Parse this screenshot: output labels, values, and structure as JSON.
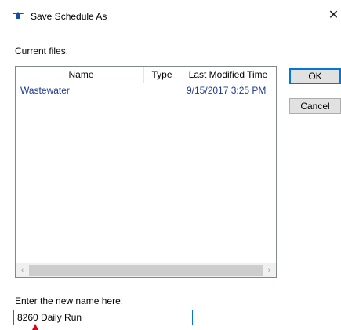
{
  "dialog": {
    "title": "Save Schedule As",
    "close_glyph": "✕",
    "icon": "app-logo-icon"
  },
  "current_files_label": "Current files:",
  "file_list": {
    "columns": [
      "Name",
      "Type",
      "Last Modified Time"
    ],
    "rows": [
      {
        "name": "Wastewater",
        "type": "",
        "last_modified": "9/15/2017 3:25 PM"
      }
    ],
    "scroll_left_glyph": "‹",
    "scroll_right_glyph": "›"
  },
  "buttons": {
    "ok_label": "OK",
    "cancel_label": "Cancel"
  },
  "name_field": {
    "label": "Enter the new name here:",
    "value": "8260 Daily Run"
  },
  "colors": {
    "accent": "#0078d7",
    "link_text": "#1f3a93",
    "marker": "#e0001a"
  }
}
